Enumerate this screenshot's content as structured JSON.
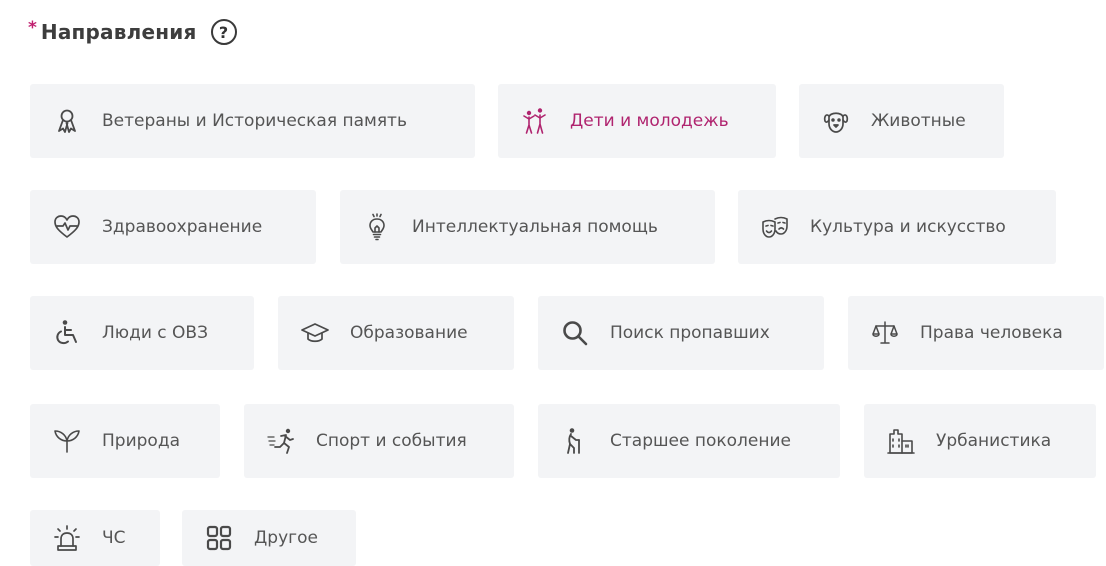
{
  "header": {
    "required_mark": "*",
    "title": "Направления",
    "help_label": "?"
  },
  "colors": {
    "accent": "#b0246f",
    "chip_bg": "#f3f4f6",
    "text": "#555555",
    "icon": "#4a4a4a"
  },
  "directions": [
    {
      "label": "Ветераны и Историческая память",
      "icon": "ribbon-icon",
      "selected": false
    },
    {
      "label": "Дети и молодежь",
      "icon": "children-icon",
      "selected": true
    },
    {
      "label": "Животные",
      "icon": "dog-icon",
      "selected": false
    },
    {
      "label": "Здравоохранение",
      "icon": "heart-pulse-icon",
      "selected": false
    },
    {
      "label": "Интеллектуальная помощь",
      "icon": "lightbulb-icon",
      "selected": false
    },
    {
      "label": "Культура и искусство",
      "icon": "theater-masks-icon",
      "selected": false
    },
    {
      "label": "Люди с ОВЗ",
      "icon": "wheelchair-icon",
      "selected": false
    },
    {
      "label": "Образование",
      "icon": "graduation-cap-icon",
      "selected": false
    },
    {
      "label": "Поиск пропавших",
      "icon": "search-icon",
      "selected": false
    },
    {
      "label": "Права человека",
      "icon": "scales-icon",
      "selected": false
    },
    {
      "label": "Природа",
      "icon": "sprout-icon",
      "selected": false
    },
    {
      "label": "Спорт и события",
      "icon": "runner-icon",
      "selected": false
    },
    {
      "label": "Старшее поколение",
      "icon": "elderly-icon",
      "selected": false
    },
    {
      "label": "Урбанистика",
      "icon": "buildings-icon",
      "selected": false
    },
    {
      "label": "ЧС",
      "icon": "alarm-light-icon",
      "selected": false
    },
    {
      "label": "Другое",
      "icon": "grid-icon",
      "selected": false
    }
  ]
}
